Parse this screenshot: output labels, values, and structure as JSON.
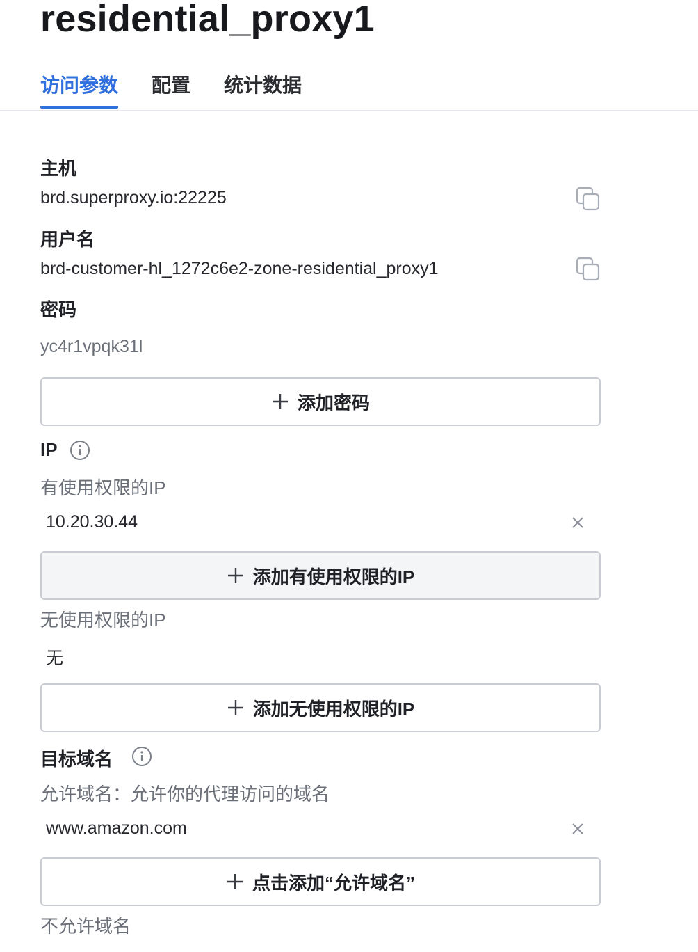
{
  "header": {
    "title": "residential_proxy1"
  },
  "tabs": [
    {
      "label": "访问参数",
      "active": true
    },
    {
      "label": "配置",
      "active": false
    },
    {
      "label": "统计数据",
      "active": false
    }
  ],
  "access": {
    "host": {
      "label": "主机",
      "value": "brd.superproxy.io:22225"
    },
    "username": {
      "label": "用户名",
      "value": "brd-customer-hl_1272c6e2-zone-residential_proxy1"
    },
    "password": {
      "label": "密码",
      "value": "yc4r1vpqk31l",
      "add_label": "添加密码"
    }
  },
  "ip": {
    "label": "IP",
    "allowed": {
      "label": "有使用权限的IP",
      "items": [
        "10.20.30.44"
      ],
      "add_label": "添加有使用权限的IP"
    },
    "denied": {
      "label": "无使用权限的IP",
      "empty_text": "无",
      "add_label": "添加无使用权限的IP"
    }
  },
  "domains": {
    "label": "目标域名",
    "allowed": {
      "label": "允许域名：允许你的代理访问的域名",
      "items": [
        "www.amazon.com"
      ],
      "add_label": "点击添加“允许域名”"
    },
    "denied": {
      "label": "不允许域名"
    }
  },
  "colors": {
    "accent": "#2f6fde",
    "border": "#c9ccd2",
    "muted_text": "#6b6f78"
  },
  "icons": {
    "copy": "copy-icon",
    "info": "info-icon",
    "remove": "close-icon",
    "add": "plus-icon"
  }
}
